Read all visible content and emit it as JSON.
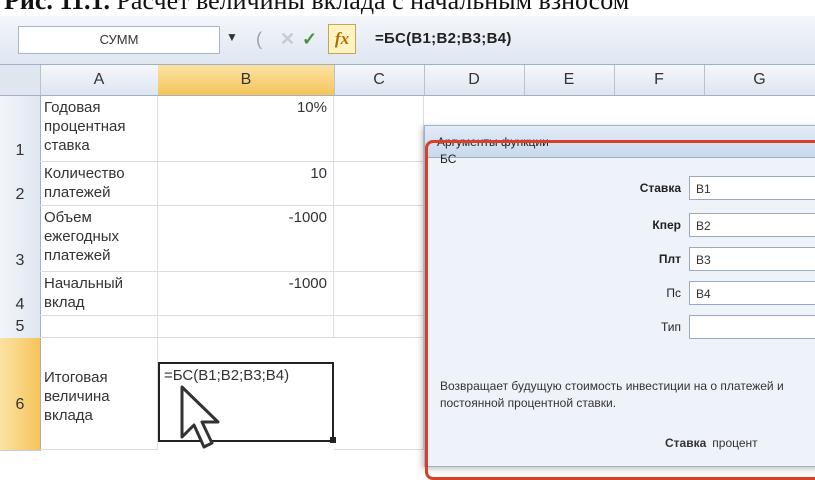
{
  "caption": {
    "prefix": "Рис. 11.1.",
    "text": "Расчет величины вклада с начальным взносом"
  },
  "formula_bar": {
    "namebox": "СУММ",
    "formula": "=БС(B1;B2;B3;B4)"
  },
  "columns": [
    "A",
    "B",
    "C",
    "D",
    "E",
    "F",
    "G"
  ],
  "rows": [
    {
      "num": "1",
      "label": "Годовая процентная ставка",
      "value": "10%"
    },
    {
      "num": "2",
      "label": "Количество платежей",
      "value": "10"
    },
    {
      "num": "3",
      "label": "Объем ежегодных платежей",
      "value": "-1000"
    },
    {
      "num": "4",
      "label": "Начальный вклад",
      "value": "-1000"
    },
    {
      "num": "5",
      "label": "",
      "value": ""
    },
    {
      "num": "6",
      "label": "Итоговая величина вклада",
      "value": "=БС(B1;B2;B3;B4)"
    }
  ],
  "dialog": {
    "title": "Аргументы функции",
    "function_name": "БС",
    "args": [
      {
        "label": "Ставка",
        "value": "B1"
      },
      {
        "label": "Кпер",
        "value": "B2"
      },
      {
        "label": "Плт",
        "value": "B3"
      },
      {
        "label": "Пс",
        "value": "B4"
      },
      {
        "label": "Тип",
        "value": ""
      }
    ],
    "description": "Возвращает будущую стоимость инвестиции на о платежей и постоянной процентной ставки.",
    "arg_help_label": "Ставка",
    "arg_help_text": "процент"
  }
}
